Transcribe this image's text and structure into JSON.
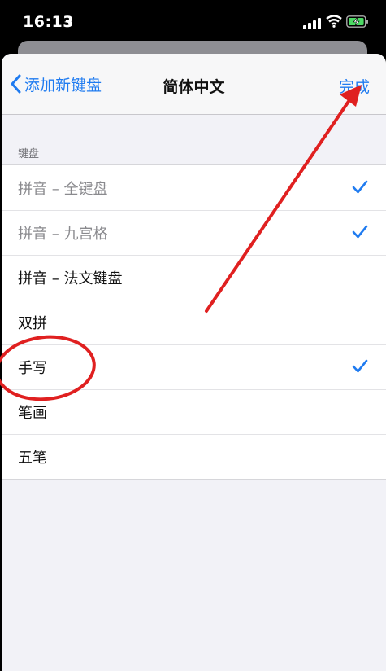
{
  "status_bar": {
    "time": "16:13",
    "icons": [
      "location-arrow-icon",
      "signal-icon",
      "wifi-icon",
      "battery-charging-icon"
    ]
  },
  "nav": {
    "back_label": "添加新键盘",
    "title": "简体中文",
    "done_label": "完成"
  },
  "section": {
    "header": "键盘",
    "items": [
      {
        "label": "拼音 – 全键盘",
        "checked": true,
        "disabled": true
      },
      {
        "label": "拼音 – 九宫格",
        "checked": true,
        "disabled": true
      },
      {
        "label": "拼音 – 法文键盘",
        "checked": false,
        "disabled": false
      },
      {
        "label": "双拼",
        "checked": false,
        "disabled": false
      },
      {
        "label": "手写",
        "checked": true,
        "disabled": false
      },
      {
        "label": "笔画",
        "checked": false,
        "disabled": false
      },
      {
        "label": "五笔",
        "checked": false,
        "disabled": false
      }
    ]
  },
  "colors": {
    "accent": "#1f7bf0",
    "annotation": "#e02020",
    "background": "#f2f2f7"
  }
}
